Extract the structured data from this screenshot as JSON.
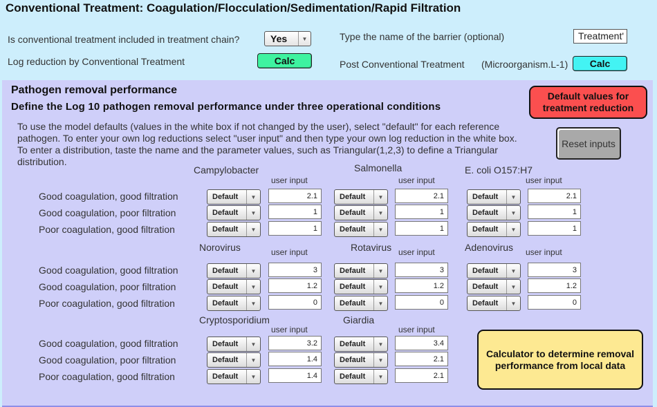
{
  "header": {
    "title": "Conventional Treatment: Coagulation/Flocculation/Sedimentation/Rapid Filtration",
    "included_question": "Is conventional treatment included in treatment chain?",
    "included_value": "Yes",
    "log_reduction_label": "Log reduction by Conventional Treatment",
    "calc_label": "Calc",
    "barrier_name_label": "Type the name of the barrier (optional)",
    "barrier_name_value": "Treatment'",
    "post_label": "Post Conventional Treatment",
    "post_units": "(Microorganism.L-1)",
    "post_calc_label": "Calc"
  },
  "panel": {
    "title": "Pathogen removal performance",
    "subtitle": "Define the Log 10 pathogen removal performance under three operational conditions",
    "description": "To use the model defaults (values in the white box if not changed by the user), select \"default\" for each reference pathogen.  To enter your own log reductions select \"user input\" and then type your own log reduction in the white box. To enter a distribution, taste the name and the parameter values, such as Triangular(1,2,3) to define a Triangular distribution.",
    "default_values_button": "Default values for treatment reduction",
    "reset_button": "Reset inputs",
    "calculator_button": "Calculator to determine removal performance from local data",
    "user_input_label": "user input",
    "conditions": [
      "Good coagulation, good filtration",
      "Good coagulation, poor filtration",
      "Poor coagulation, good filtration"
    ],
    "pathogens": [
      {
        "name": "Campylobacter",
        "modes": [
          "Default",
          "Default",
          "Default"
        ],
        "values": [
          "2.1",
          "1",
          "1"
        ]
      },
      {
        "name": "Salmonella",
        "modes": [
          "Default",
          "Default",
          "Default"
        ],
        "values": [
          "2.1",
          "1",
          "1"
        ]
      },
      {
        "name": "E. coli O157:H7",
        "modes": [
          "Default",
          "Default",
          "Default"
        ],
        "values": [
          "2.1",
          "1",
          "1"
        ]
      },
      {
        "name": "Norovirus",
        "modes": [
          "Default",
          "Default",
          "Default"
        ],
        "values": [
          "3",
          "1.2",
          "0"
        ]
      },
      {
        "name": "Rotavirus",
        "modes": [
          "Default",
          "Default",
          "Default"
        ],
        "values": [
          "3",
          "1.2",
          "0"
        ]
      },
      {
        "name": "Adenovirus",
        "modes": [
          "Default",
          "Default",
          "Default"
        ],
        "values": [
          "3",
          "1.2",
          "0"
        ]
      },
      {
        "name": "Cryptosporidium",
        "modes": [
          "Default",
          "Default",
          "Default"
        ],
        "values": [
          "3.2",
          "1.4",
          "1.4"
        ]
      },
      {
        "name": "Giardia",
        "modes": [
          "Default",
          "Default",
          "Default"
        ],
        "values": [
          "3.4",
          "2.1",
          "2.1"
        ]
      }
    ]
  },
  "icons": {
    "dropdown_arrow": "▼"
  }
}
